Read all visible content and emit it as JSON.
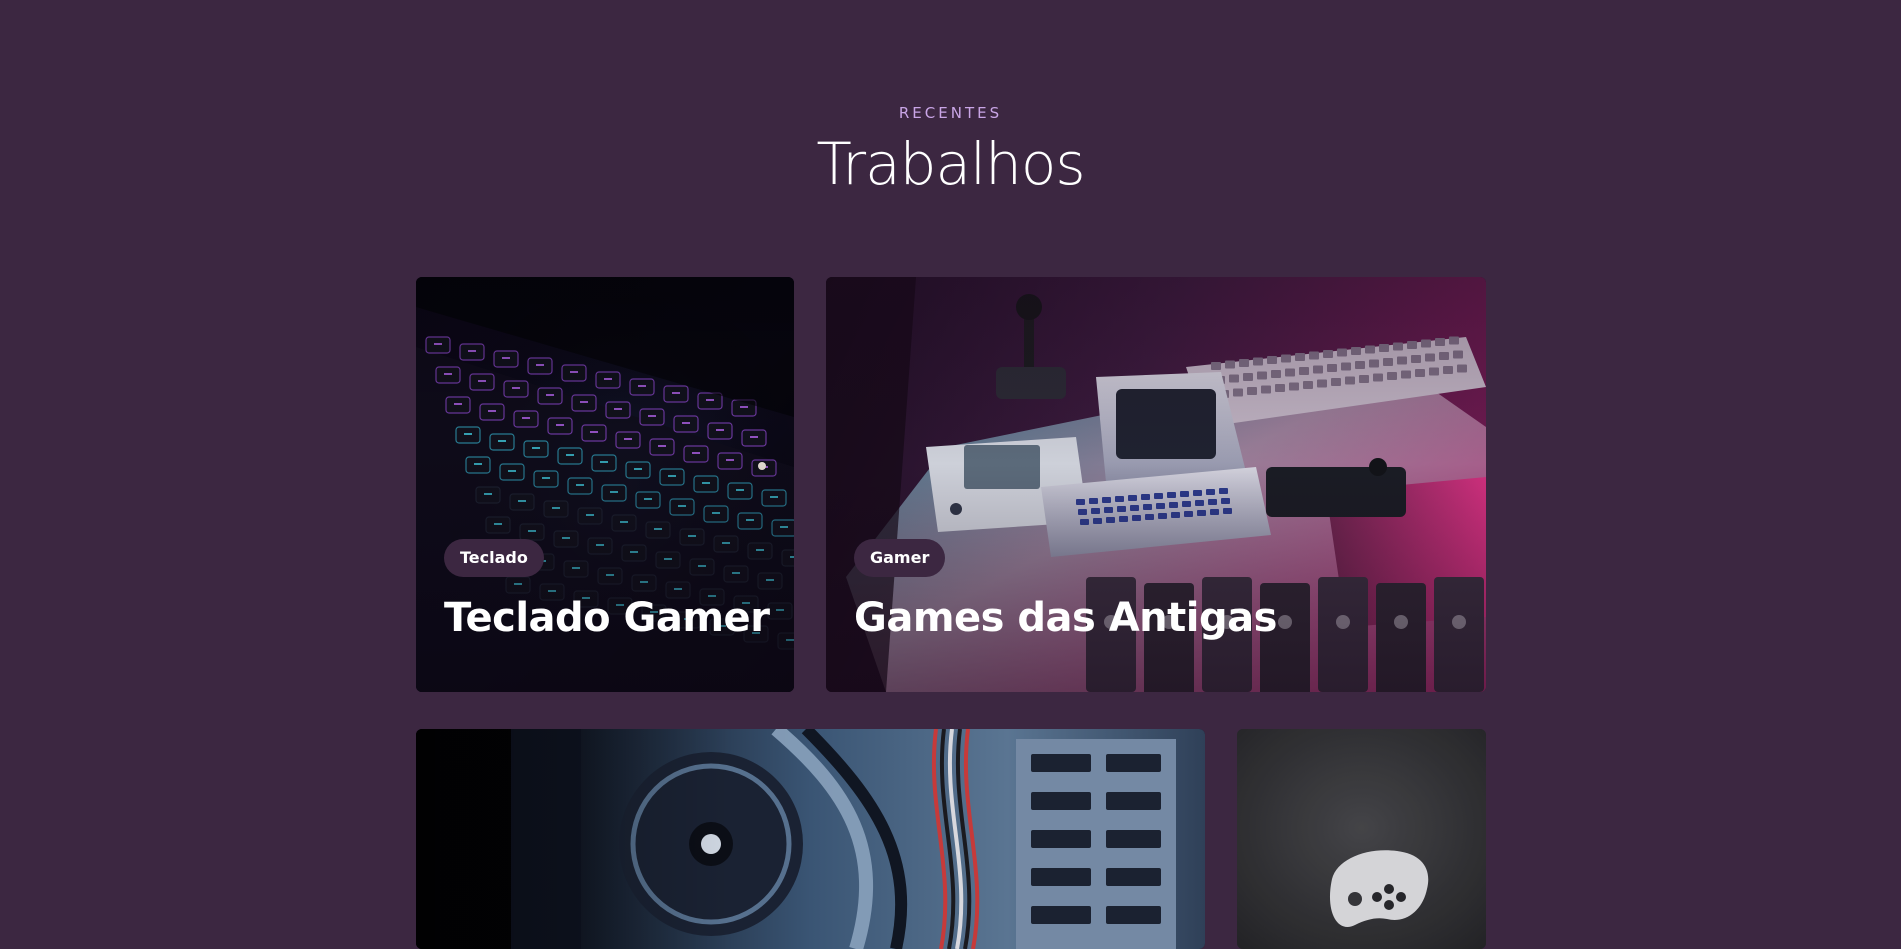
{
  "section": {
    "eyebrow": "RECENTES",
    "title": "Trabalhos"
  },
  "colors": {
    "background": "#3c2741",
    "eyebrow": "#c9a5e6",
    "tag_background": "#3c2741",
    "text": "#ffffff"
  },
  "works": [
    {
      "tag": "Teclado",
      "title": "Teclado Gamer",
      "image": "keyboard-photo"
    },
    {
      "tag": "Gamer",
      "title": "Games das Antigas",
      "image": "retro-consoles-photo"
    },
    {
      "tag": "",
      "title": "",
      "image": "pc-hardware-photo"
    },
    {
      "tag": "",
      "title": "",
      "image": "game-controller-photo"
    }
  ]
}
